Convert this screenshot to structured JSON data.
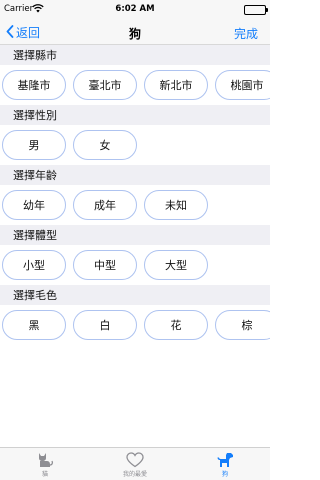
{
  "status_bar": {
    "carrier": "Carrier",
    "time": "6:02 AM"
  },
  "nav": {
    "back_label": "返回",
    "title": "狗",
    "done_label": "完成"
  },
  "sections": [
    {
      "title": "選擇縣市",
      "options": [
        "基隆市",
        "臺北市",
        "新北市",
        "桃園市"
      ]
    },
    {
      "title": "選擇性別",
      "options": [
        "男",
        "女"
      ]
    },
    {
      "title": "選擇年齡",
      "options": [
        "幼年",
        "成年",
        "未知"
      ]
    },
    {
      "title": "選擇體型",
      "options": [
        "小型",
        "中型",
        "大型"
      ]
    },
    {
      "title": "選擇毛色",
      "options": [
        "黑",
        "白",
        "花",
        "棕"
      ]
    }
  ],
  "tab_bar": {
    "items": [
      {
        "label": "貓",
        "icon": "cat-icon"
      },
      {
        "label": "我的最愛",
        "icon": "heart-icon"
      },
      {
        "label": "狗",
        "icon": "dog-icon",
        "active": true
      }
    ]
  },
  "colors": {
    "accent": "#147efb",
    "chip_border": "#aec3f0",
    "section_bg": "#efeff4"
  }
}
